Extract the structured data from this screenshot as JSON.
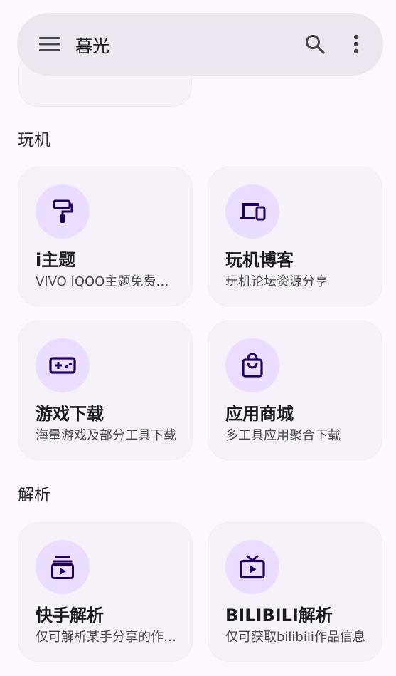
{
  "search_bar": {
    "title": "暮光"
  },
  "sections": [
    {
      "title": "玩机",
      "cards": [
        {
          "title": "i主题",
          "subtitle": "VIVO IQOO主题免费破解",
          "icon": "paint-roller-icon"
        },
        {
          "title": "玩机博客",
          "subtitle": "玩机论坛资源分享",
          "icon": "devices-icon"
        },
        {
          "title": "游戏下载",
          "subtitle": "海量游戏及部分工具下载",
          "icon": "gamepad-icon"
        },
        {
          "title": "应用商城",
          "subtitle": "多工具应用聚合下载",
          "icon": "shopping-bag-icon"
        }
      ]
    },
    {
      "title": "解析",
      "cards": [
        {
          "title": "快手解析",
          "subtitle": "仅可解析某手分享的作品链接",
          "icon": "video-library-icon"
        },
        {
          "title": "BILIBILI解析",
          "subtitle": "仅可获取bilibili作品信息",
          "icon": "tv-icon"
        }
      ]
    }
  ],
  "colors": {
    "background": "#fef7ff",
    "search_bar": "#ece6f0",
    "card": "#f7f2fa",
    "icon_circle": "#eaddff",
    "icon": "#21005d"
  }
}
